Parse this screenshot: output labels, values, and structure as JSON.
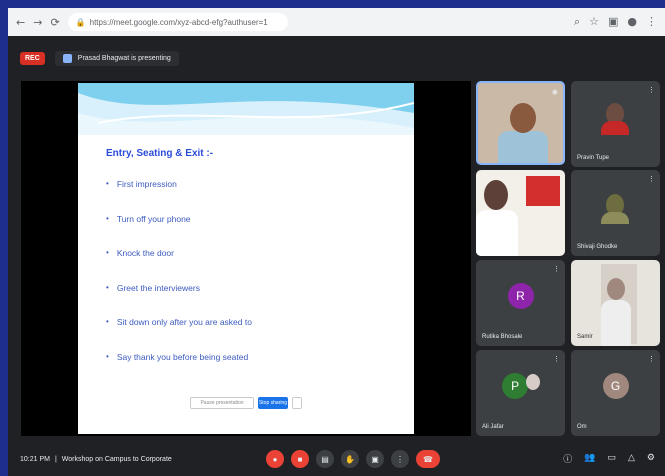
{
  "browser": {
    "url": "https://meet.google.com/xyz-abcd-efg?authuser=1",
    "nav_icons": [
      "back-icon",
      "forward-icon",
      "reload-icon"
    ],
    "right_icons": [
      "zoom-icon",
      "bookmark-icon",
      "extension-icon",
      "profile-icon",
      "menu-icon"
    ]
  },
  "meet": {
    "rec_label": "REC",
    "presenting_label": "Prasad Bhagwat is presenting",
    "slide": {
      "title": "Entry, Seating & Exit :-",
      "bullets": [
        "First impression",
        "Turn off your phone",
        "Knock the door",
        "Greet the interviewers",
        "Sit down only after you are asked to",
        "Say thank you before being seated"
      ],
      "control_left": "Pause presentation",
      "control_right": "Stop sharing"
    },
    "participants": [
      {
        "name": "",
        "type": "video"
      },
      {
        "name": "Pravin Tupe",
        "type": "video-small"
      },
      {
        "name": "",
        "type": "video"
      },
      {
        "name": "Shivaji Ghodke",
        "type": "video-small"
      },
      {
        "name": "Rutika Bhosale",
        "type": "avatar",
        "initial": "R",
        "color": "#8e24aa"
      },
      {
        "name": "Samir",
        "type": "video"
      },
      {
        "name": "Ali Jafar",
        "type": "avatar",
        "initial": "P",
        "color": "#2e7d32"
      },
      {
        "name": "Om",
        "type": "avatar",
        "initial": "G",
        "color": "#a1887f"
      }
    ],
    "bottom": {
      "time": "10:21 PM",
      "separator": "|",
      "meeting_name": "Workshop on Campus to Corporate",
      "controls": [
        "mic-off-icon",
        "camera-off-icon",
        "captions-icon",
        "raise-hand-icon",
        "present-icon",
        "more-icon"
      ],
      "end_label": "",
      "right_controls": [
        "info-icon",
        "people-icon",
        "chat-icon",
        "activities-icon",
        "host-controls-icon"
      ]
    }
  }
}
